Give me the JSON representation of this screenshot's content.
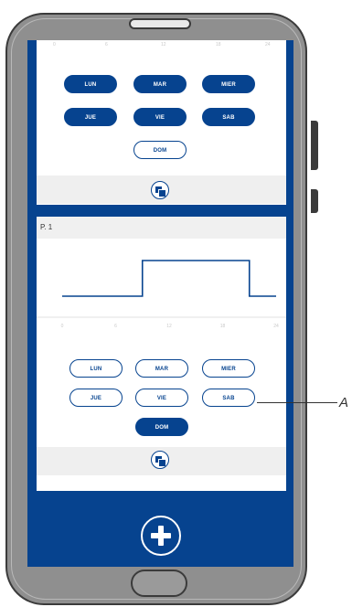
{
  "top_panel": {
    "axis_ticks": [
      "0",
      "6",
      "12",
      "18",
      "24"
    ],
    "days": [
      {
        "label": "LUN",
        "active": true
      },
      {
        "label": "MAR",
        "active": true
      },
      {
        "label": "MIER",
        "active": true
      },
      {
        "label": "JUE",
        "active": true
      },
      {
        "label": "VIE",
        "active": true
      },
      {
        "label": "SAB",
        "active": true
      },
      {
        "label": "DOM",
        "active": false
      }
    ]
  },
  "bottom_panel": {
    "title": "P. 1",
    "axis_ticks": [
      "0",
      "6",
      "12",
      "18",
      "24"
    ],
    "days": [
      {
        "label": "LUN",
        "active": false
      },
      {
        "label": "MAR",
        "active": false
      },
      {
        "label": "MIER",
        "active": false
      },
      {
        "label": "JUE",
        "active": false
      },
      {
        "label": "VIE",
        "active": false
      },
      {
        "label": "SAB",
        "active": false
      },
      {
        "label": "DOM",
        "active": true
      }
    ]
  },
  "chart_data": {
    "type": "line",
    "title": "P. 1",
    "xlabel": "",
    "ylabel": "",
    "x": [
      0,
      9,
      9,
      21,
      21,
      24
    ],
    "y": [
      0,
      0,
      1,
      1,
      0,
      0
    ],
    "xlim": [
      0,
      24
    ],
    "ylim": [
      0,
      1
    ],
    "x_ticks": [
      "0",
      "6",
      "12",
      "18",
      "24"
    ]
  },
  "colors": {
    "accent": "#06438f",
    "panel_bg": "#ffffff",
    "bar_bg": "#efefef"
  },
  "icons": {
    "copy": "copy-icon",
    "add": "plus-icon"
  },
  "callout": {
    "label": "A"
  }
}
